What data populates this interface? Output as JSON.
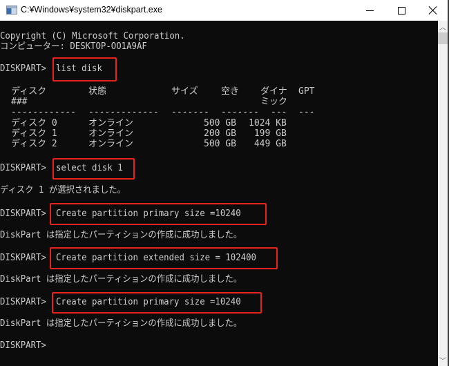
{
  "window": {
    "title": "C:¥Windows¥system32¥diskpart.exe",
    "controls": {
      "minimize": "minimize",
      "maximize": "maximize",
      "close": "close"
    }
  },
  "console": {
    "copyright": "Copyright (C) Microsoft Corporation.",
    "computer": "コンピューター: DESKTOP-OO1A9AF",
    "prompt": "DISKPART>",
    "commands": [
      "list disk",
      "select disk 1",
      "Create partition primary size =10240",
      "Create partition extended size = 102400",
      "Create partition primary size =10240"
    ],
    "table": {
      "headers": {
        "disk": "ディスク",
        "disk_sub": "###",
        "status": "状態",
        "size": "サイズ",
        "free": "空き",
        "dyn": "ダイナ",
        "dyn_sub": "ミック",
        "gpt": "GPT"
      },
      "separators": {
        "disk": "------------",
        "status": "-------------",
        "size": "-------",
        "free": "-------",
        "dyn": "---",
        "gpt": "---"
      },
      "rows": [
        {
          "disk": "ディスク 0",
          "status": "オンライン",
          "size": "500 GB",
          "free": "1024 KB",
          "dyn": "",
          "gpt": ""
        },
        {
          "disk": "ディスク 1",
          "status": "オンライン",
          "size": "200 GB",
          "free": " 199 GB",
          "dyn": "",
          "gpt": ""
        },
        {
          "disk": "ディスク 2",
          "status": "オンライン",
          "size": "500 GB",
          "free": " 449 GB",
          "dyn": "",
          "gpt": ""
        }
      ]
    },
    "select_result": "ディスク 1 が選択されました。",
    "create_result": "DiskPart は指定したパーティションの作成に成功しました。"
  },
  "colors": {
    "console_bg": "#0c0c0c",
    "console_text": "#cccccc",
    "highlight": "#e8231a"
  }
}
